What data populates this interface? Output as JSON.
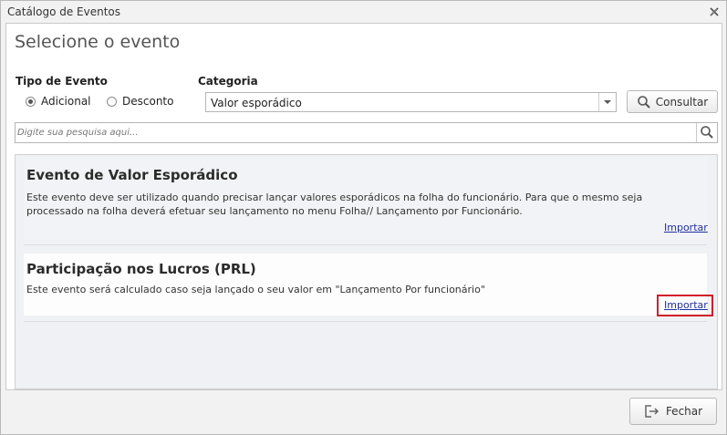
{
  "window": {
    "title": "Catálogo de Eventos"
  },
  "heading": "Selecione o evento",
  "tipo_evento": {
    "label": "Tipo de Evento",
    "options": [
      {
        "label": "Adicional",
        "selected": true
      },
      {
        "label": "Desconto",
        "selected": false
      }
    ]
  },
  "categoria": {
    "label": "Categoria",
    "value": "Valor esporádico"
  },
  "consultar_label": "Consultar",
  "search": {
    "placeholder": "Digite sua pesquisa aqui...",
    "value": ""
  },
  "events": [
    {
      "title": "Evento de Valor Esporádico",
      "description": "Este evento deve ser utilizado quando precisar lançar valores esporádicos na folha do funcionário. Para que o mesmo seja processado na folha deverá efetuar seu lançamento no menu Folha// Lançamento por Funcionário.",
      "import_label": "Importar"
    },
    {
      "title": "Participação nos Lucros (PRL)",
      "description": "Este evento será calculado caso seja lançado o seu valor em \"Lançamento Por funcionário\"",
      "import_label": "Importar"
    }
  ],
  "fechar_label": "Fechar",
  "colors": {
    "highlight": "#d11f2a",
    "link": "#2030a0"
  }
}
